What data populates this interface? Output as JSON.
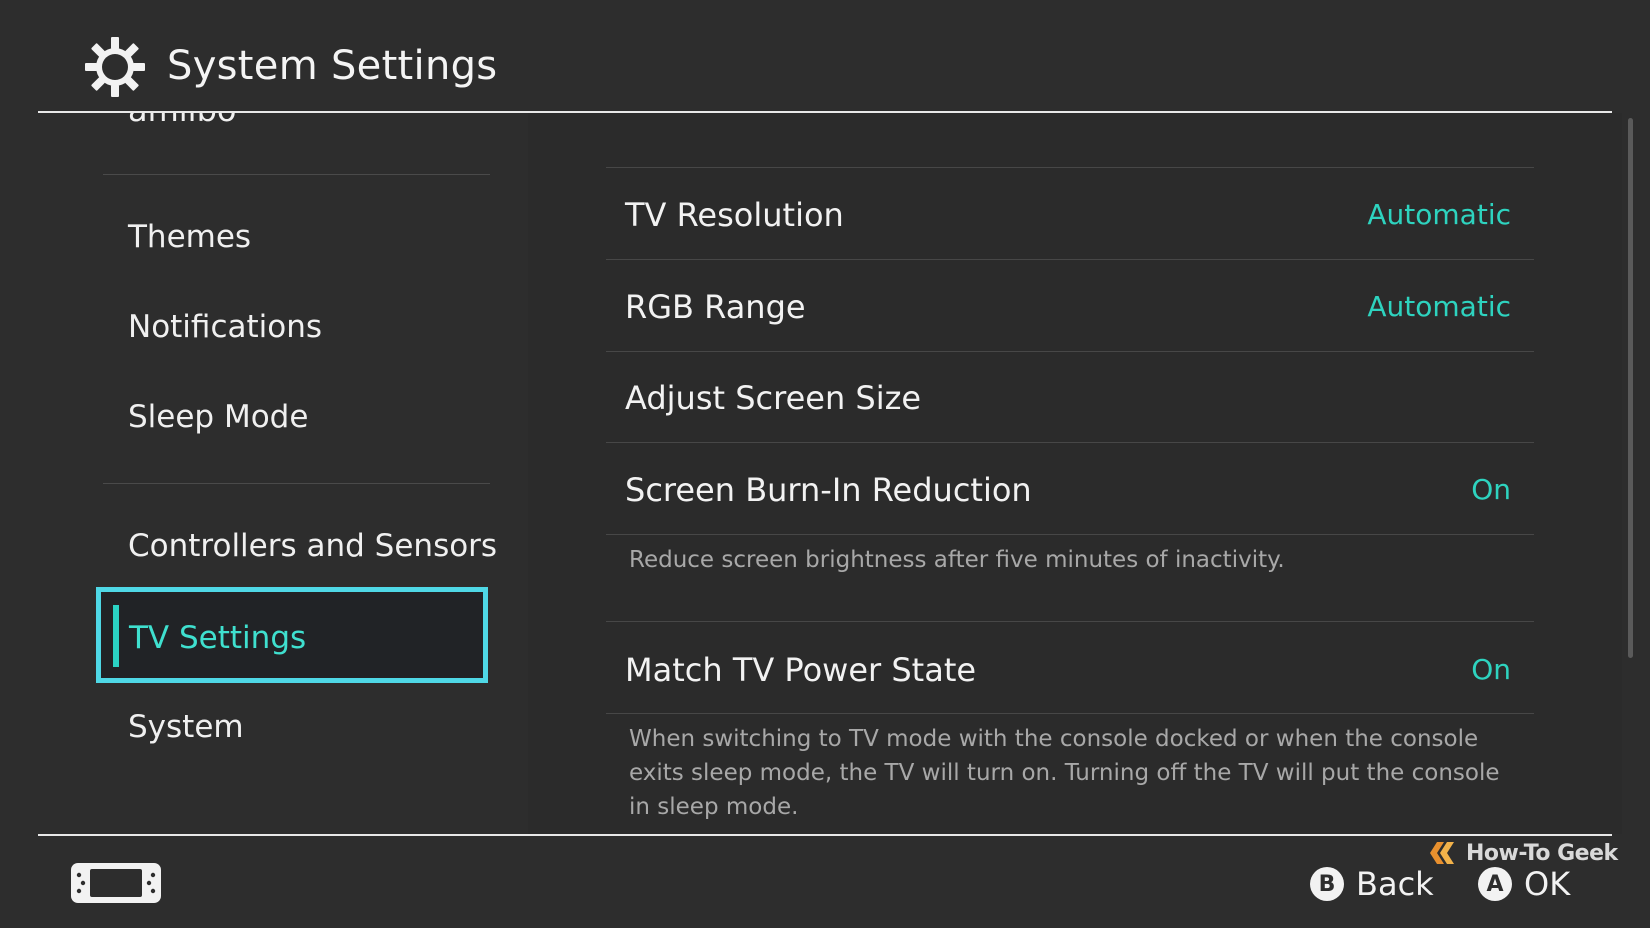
{
  "header": {
    "title": "System Settings",
    "icon": "gear-icon"
  },
  "sidebar": {
    "clipped_item": "amiibo",
    "items": [
      {
        "label": "Themes"
      },
      {
        "label": "Notifications"
      },
      {
        "label": "Sleep Mode"
      },
      {
        "label": "Controllers and Sensors"
      },
      {
        "label": "TV Settings",
        "selected": true
      },
      {
        "label": "System"
      }
    ]
  },
  "content": {
    "rows": [
      {
        "label": "TV Resolution",
        "value": "Automatic"
      },
      {
        "label": "RGB Range",
        "value": "Automatic"
      },
      {
        "label": "Adjust Screen Size",
        "value": ""
      },
      {
        "label": "Screen Burn-In Reduction",
        "value": "On",
        "description": "Reduce screen brightness after five minutes of inactivity."
      },
      {
        "label": "Match TV Power State",
        "value": "On",
        "description": "When switching to TV mode with the console docked or when the console exits sleep mode, the TV will turn on. Turning off the TV will put the console in sleep mode."
      }
    ]
  },
  "footer": {
    "console_icon": "handheld-console-icon",
    "watermark": "How-To Geek",
    "back": {
      "button": "B",
      "label": "Back"
    },
    "ok": {
      "button": "A",
      "label": "OK"
    }
  },
  "colors": {
    "accent": "#2ed3bf",
    "selection_border": "#4fd8e6",
    "background": "#2d2d2d"
  }
}
